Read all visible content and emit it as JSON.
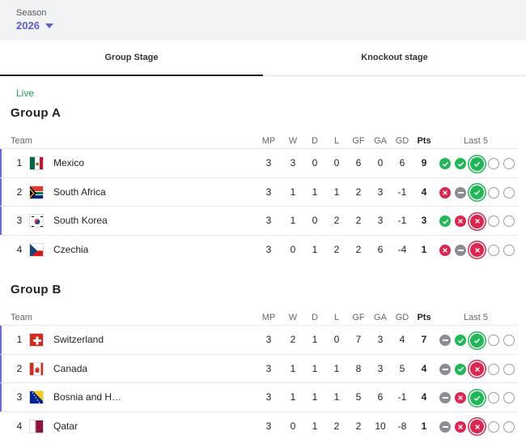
{
  "season": {
    "label": "Season",
    "value": "2026"
  },
  "tabs": [
    {
      "label": "Group Stage",
      "active": true
    },
    {
      "label": "Knockout stage",
      "active": false
    }
  ],
  "live_label": "Live",
  "columns": {
    "team": "Team",
    "mp": "MP",
    "w": "W",
    "d": "D",
    "l": "L",
    "gf": "GF",
    "ga": "GA",
    "gd": "GD",
    "pts": "Pts",
    "last5": "Last 5"
  },
  "groups": [
    {
      "name": "Group A",
      "rows": [
        {
          "rank": "1",
          "team": "Mexico",
          "flag": "mexico-flag",
          "mp": "3",
          "w": "3",
          "d": "0",
          "l": "0",
          "gf": "6",
          "ga": "0",
          "gd": "6",
          "pts": "9",
          "form": [
            "W",
            "W",
            "W",
            "",
            ""
          ]
        },
        {
          "rank": "2",
          "team": "South Africa",
          "flag": "south-africa-flag",
          "mp": "3",
          "w": "1",
          "d": "1",
          "l": "1",
          "gf": "2",
          "ga": "3",
          "gd": "-1",
          "pts": "4",
          "form": [
            "L",
            "D",
            "W",
            "",
            ""
          ]
        },
        {
          "rank": "3",
          "team": "South Korea",
          "flag": "south-korea-flag",
          "mp": "3",
          "w": "1",
          "d": "0",
          "l": "2",
          "gf": "2",
          "ga": "3",
          "gd": "-1",
          "pts": "3",
          "form": [
            "W",
            "L",
            "L",
            "",
            ""
          ]
        },
        {
          "rank": "4",
          "team": "Czechia",
          "flag": "czechia-flag",
          "mp": "3",
          "w": "0",
          "d": "1",
          "l": "2",
          "gf": "2",
          "ga": "6",
          "gd": "-4",
          "pts": "1",
          "form": [
            "L",
            "D",
            "L",
            "",
            ""
          ]
        }
      ]
    },
    {
      "name": "Group B",
      "rows": [
        {
          "rank": "1",
          "team": "Switzerland",
          "flag": "switzerland-flag",
          "mp": "3",
          "w": "2",
          "d": "1",
          "l": "0",
          "gf": "7",
          "ga": "3",
          "gd": "4",
          "pts": "7",
          "form": [
            "D",
            "W",
            "W",
            "",
            ""
          ]
        },
        {
          "rank": "2",
          "team": "Canada",
          "flag": "canada-flag",
          "mp": "3",
          "w": "1",
          "d": "1",
          "l": "1",
          "gf": "8",
          "ga": "3",
          "gd": "5",
          "pts": "4",
          "form": [
            "D",
            "W",
            "L",
            "",
            ""
          ]
        },
        {
          "rank": "3",
          "team": "Bosnia and H…",
          "flag": "bosnia-flag",
          "mp": "3",
          "w": "1",
          "d": "1",
          "l": "1",
          "gf": "5",
          "ga": "6",
          "gd": "-1",
          "pts": "4",
          "form": [
            "D",
            "L",
            "W",
            "",
            ""
          ]
        },
        {
          "rank": "4",
          "team": "Qatar",
          "flag": "qatar-flag",
          "mp": "3",
          "w": "0",
          "d": "1",
          "l": "2",
          "gf": "2",
          "ga": "10",
          "gd": "-8",
          "pts": "1",
          "form": [
            "D",
            "L",
            "L",
            "",
            ""
          ]
        }
      ]
    }
  ],
  "colors": {
    "accent": "#5b5bd6",
    "win": "#1db954",
    "loss": "#e0244d",
    "draw": "#8a8d94",
    "live": "#1aa64a"
  }
}
